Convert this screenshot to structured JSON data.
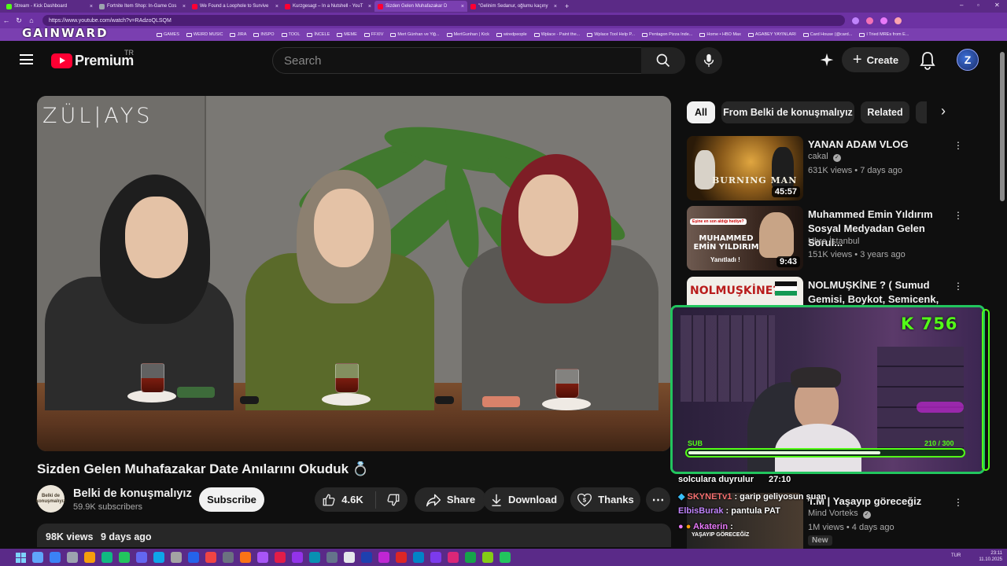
{
  "browser": {
    "tabs": [
      {
        "label": "Stream - Kick Dashboard",
        "color": "#53fc18"
      },
      {
        "label": "Fortnite Item Shop: In-Game Cos",
        "color": "#9ca3af"
      },
      {
        "label": "We Found a Loophole to Survive",
        "color": "#ff0033"
      },
      {
        "label": "Kurzgesagt – In a Nutshell - YouT",
        "color": "#ff0033"
      },
      {
        "label": "Sizden Gelen Muhafazakar D",
        "color": "#ff0033"
      },
      {
        "label": "\"Gelinim Sedanur, oğlumu kaçıny",
        "color": "#ff0033"
      }
    ],
    "new_tab": "+",
    "url": "https://www.youtube.com/watch?v=RAdzoQLSQM",
    "overlay_logo": "GAINWARD",
    "bookmarks": [
      "GAMES",
      "WEIRD MUSIC",
      "JIRA",
      "INSPO",
      "TOOL",
      "İNCELE",
      "MEME",
      "FFXIV",
      "Mert Günhan ve Yiğ...",
      "MertGunhan | Kick",
      "wiredpeople",
      "Wplace - Paint the...",
      "Wplace Tool Help P...",
      "Pentagon Pizza Inde...",
      "Home • HBO Max",
      "AGABEY YAYINLARI",
      "Card House (@card...",
      "I Tried MREs from E..."
    ]
  },
  "header": {
    "brand": "Premium",
    "region": "TR",
    "search_placeholder": "Search",
    "create_label": "Create",
    "avatar_letter": "Z"
  },
  "video": {
    "watermark": "ZÜL|AYS",
    "title": "Sizden Gelen Muhafazakar Date Anılarını Okuduk 💍",
    "channel": "Belki de konuşmalıyız",
    "channel_avatar_text": "Belki de konuşmalıyız",
    "subscribers": "59.9K subscribers",
    "subscribe_label": "Subscribe",
    "likes": "4.6K",
    "share_label": "Share",
    "download_label": "Download",
    "thanks_label": "Thanks",
    "views": "98K views",
    "age": "9 days ago"
  },
  "chips": [
    "All",
    "From Belki de konuşmalıyız",
    "Related"
  ],
  "recommendations": [
    {
      "title": "YANAN ADAM VLOG",
      "channel": "cakal",
      "verified": true,
      "meta": "631K views • 7 days ago",
      "duration": "45:57",
      "thumb_text": "BURNING MAN",
      "thumb_colors": [
        "#3a2a12",
        "#b6862d"
      ]
    },
    {
      "title": "Muhammed Emin Yıldırım Sosyal Medyadan Gelen Sorul...",
      "channel": "Uhre İstanbul",
      "verified": false,
      "meta": "151K views • 3 years ago",
      "duration": "9:43",
      "thumb_text": "MUHAMMED EMİN YILDIRIM",
      "thumb_subtext": "Yanıtladı !",
      "thumb_tag": "Eşine en son aldığı hediye?",
      "thumb_colors": [
        "#4a3228",
        "#c09a80"
      ]
    },
    {
      "title": "NOLMUŞKİNE ? ( Sumud Gemisi, Boykot, Semicenk, ...",
      "thumb_text": "NOLMUŞKİNE?",
      "thumb_colors": [
        "#f1efe9",
        "#d9d3c6"
      ]
    },
    {
      "title": "T.M | Yaşayıp göreceğiz",
      "channel": "Mind Vorteks",
      "verified": true,
      "meta": "1M views • 4 days ago",
      "badge": "New",
      "thumb_text": "YAŞAYIP GÖRECEĞİZ",
      "thumb_colors": [
        "#2a2a2a",
        "#5a4a3a"
      ]
    }
  ],
  "overlay": {
    "kick_count": "K 756",
    "sub_label": "SUB",
    "sub_current": 210,
    "sub_goal": 300,
    "sub_text": "210 / 300",
    "chat": [
      {
        "user": "",
        "text": "solculara duyrulur",
        "user_color": "#ffffff",
        "time": "27:10"
      },
      {
        "user": "SKYNETv1",
        "text": ": garip geliyosun şuan",
        "user_color": "#f87171"
      },
      {
        "user": "ElbisBurak",
        "text": ": pantula PAT",
        "user_color": "#c084fc"
      },
      {
        "user": "Akaterin",
        "text": ":",
        "user_color": "#e879f9"
      }
    ]
  },
  "taskbar": {
    "lang": "TUR",
    "time": "23:11",
    "date": "11.10.2025"
  }
}
